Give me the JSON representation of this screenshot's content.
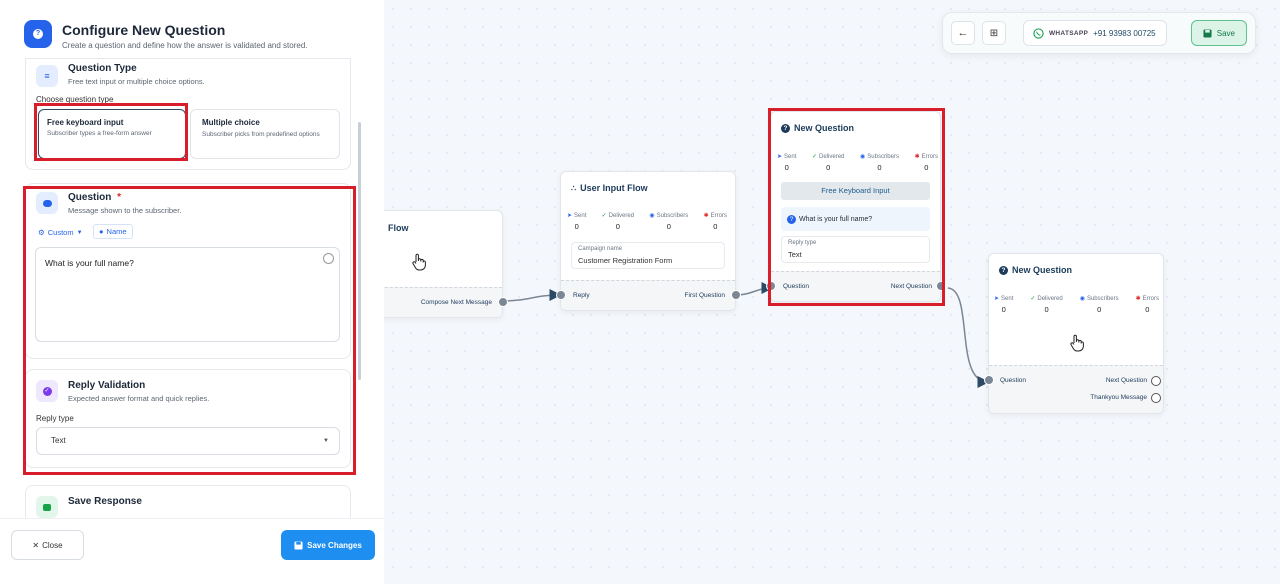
{
  "panel": {
    "title": "Configure New Question",
    "subtitle": "Create a question and define how the answer is validated and stored.",
    "question_type": {
      "title": "Question Type",
      "subtitle": "Free text input or multiple choice options.",
      "choose_label": "Choose question type",
      "options": [
        {
          "title": "Free keyboard input",
          "desc": "Subscriber types a free-form answer"
        },
        {
          "title": "Multiple choice",
          "desc": "Subscriber picks from predefined options"
        }
      ]
    },
    "question": {
      "title": "Question",
      "required_mark": "*",
      "subtitle": "Message shown to the subscriber.",
      "custom_label": "Custom",
      "name_label": "Name",
      "text": "What is your full name?"
    },
    "reply_validation": {
      "title": "Reply Validation",
      "subtitle": "Expected answer format and quick replies.",
      "reply_type_label": "Reply type",
      "reply_type_value": "Text"
    },
    "save_response": {
      "title": "Save Response"
    },
    "close_label": "Close",
    "save_changes_label": "Save Changes"
  },
  "toolbar": {
    "whatsapp_label": "WHATSAPP",
    "phone": "+91 93983 00725",
    "save_label": "Save"
  },
  "stat_labels": {
    "sent": "Sent",
    "delivered": "Delivered",
    "subscribers": "Subscribers",
    "errors": "Errors"
  },
  "nodes": {
    "flow": {
      "title": "Flow",
      "out_label": "Compose Next Message"
    },
    "user_input": {
      "title": "User Input Flow",
      "stats": [
        "0",
        "0",
        "0",
        "0"
      ],
      "campaign_label": "Campaign name",
      "campaign_value": "Customer Registration Form",
      "in_label": "Reply",
      "out_label": "First Question"
    },
    "new_q1": {
      "title": "New Question",
      "stats": [
        "0",
        "0",
        "0",
        "0"
      ],
      "type_chip": "Free Keyboard Input",
      "question_text": "What is your full name?",
      "reply_type_label": "Reply type",
      "reply_type_value": "Text",
      "in_label": "Question",
      "out_label": "Next Question"
    },
    "new_q2": {
      "title": "New Question",
      "stats": [
        "0",
        "0",
        "0",
        "0"
      ],
      "in_label": "Question",
      "out_label": "Next Question",
      "out2_label": "Thankyou Message"
    }
  },
  "colors": {
    "accent": "#2563eb",
    "highlight": "#d81e2b",
    "save_green": "#147a4a"
  }
}
